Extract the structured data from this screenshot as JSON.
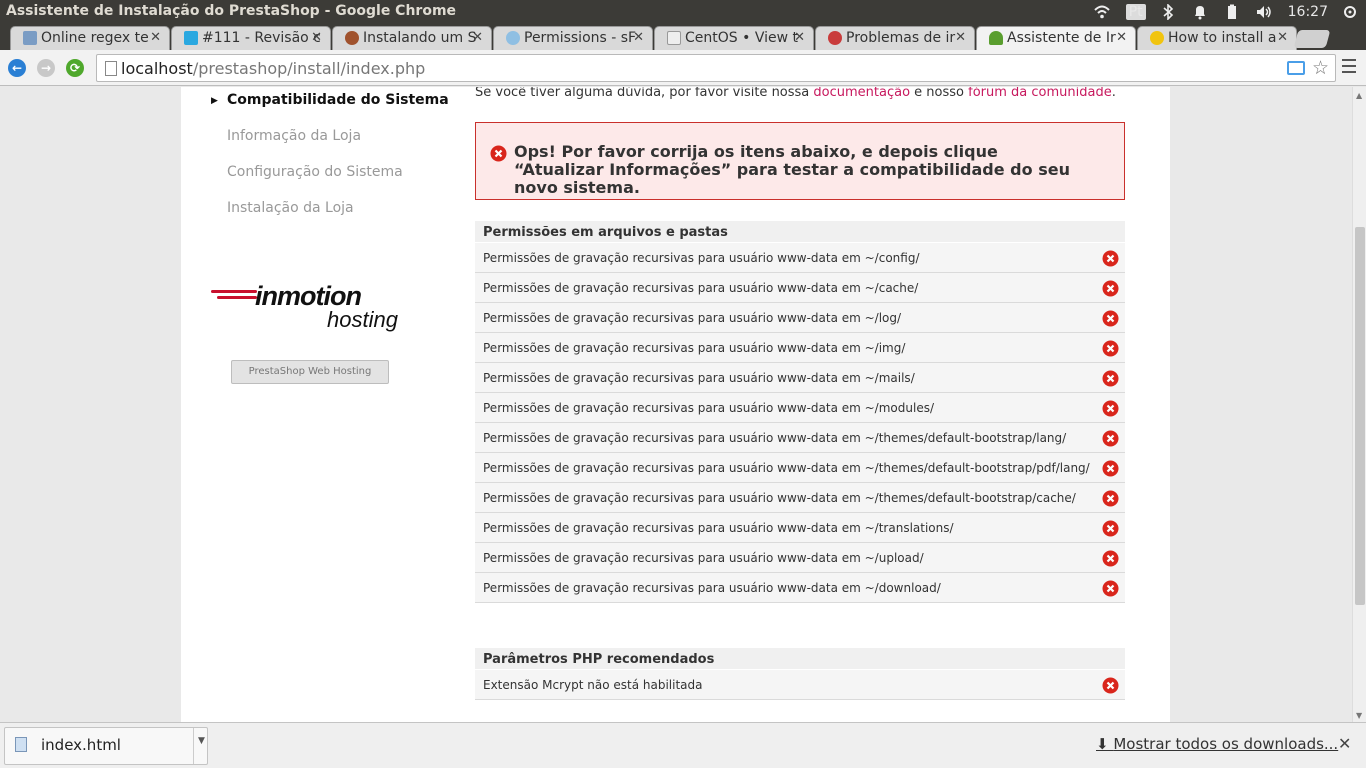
{
  "window": {
    "title": "Assistente de Instalação do PrestaShop - Google Chrome",
    "tray": {
      "lang": "Pt",
      "clock": "16:27"
    }
  },
  "tabs": [
    {
      "label": "Online regex te",
      "favicon_color": "#7a9cc4"
    },
    {
      "label": "#111 - Revisão c",
      "favicon_color": "#2aa8e0"
    },
    {
      "label": "Instalando um S",
      "favicon_color": "#a0522d"
    },
    {
      "label": "Permissions - sF",
      "favicon_color": "#8fbfe3"
    },
    {
      "label": "CentOS • View t",
      "favicon_color": "#eeeeee"
    },
    {
      "label": "Problemas de ir",
      "favicon_color": "#c93c3c"
    },
    {
      "label": "Assistente de Ir",
      "favicon_color": "#5a9e2f",
      "active": true
    },
    {
      "label": "How to install a",
      "favicon_color": "#f1c40f"
    }
  ],
  "toolbar": {
    "url_host": "localhost",
    "url_path": "/prestashop/install/index.php"
  },
  "sidebar": {
    "steps": [
      {
        "label": "Compatibilidade do Sistema",
        "current": true
      },
      {
        "label": "Informação da Loja"
      },
      {
        "label": "Configuração do Sistema"
      },
      {
        "label": "Instalação da Loja"
      }
    ],
    "logo_main": "inmotion",
    "logo_sub": "hosting",
    "hosting_button": "PrestaShop Web Hosting"
  },
  "main": {
    "help_prefix": "Se você tiver alguma dúvida, por favor visite nossa ",
    "help_link1": "documentação",
    "help_mid": " e nosso ",
    "help_link2": "fórum da comunidade",
    "help_suffix": ".",
    "error_message": "Ops! Por favor corrija os itens abaixo, e depois clique “Atualizar Informações” para testar a compatibilidade do seu novo sistema.",
    "permissions_title": "Permissões em arquivos e pastas",
    "permissions": [
      "Permissões de gravação recursivas para usuário www-data em ~/config/",
      "Permissões de gravação recursivas para usuário www-data em ~/cache/",
      "Permissões de gravação recursivas para usuário www-data em ~/log/",
      "Permissões de gravação recursivas para usuário www-data em ~/img/",
      "Permissões de gravação recursivas para usuário www-data em ~/mails/",
      "Permissões de gravação recursivas para usuário www-data em ~/modules/",
      "Permissões de gravação recursivas para usuário www-data em ~/themes/default-bootstrap/lang/",
      "Permissões de gravação recursivas para usuário www-data em ~/themes/default-bootstrap/pdf/lang/",
      "Permissões de gravação recursivas para usuário www-data em ~/themes/default-bootstrap/cache/",
      "Permissões de gravação recursivas para usuário www-data em ~/translations/",
      "Permissões de gravação recursivas para usuário www-data em ~/upload/",
      "Permissões de gravação recursivas para usuário www-data em ~/download/"
    ],
    "php_title": "Parâmetros PHP recomendados",
    "php_items": [
      "Extensão Mcrypt não está habilitada"
    ]
  },
  "downloads": {
    "file_name": "index.html",
    "show_all": "Mostrar todos os downloads..."
  }
}
